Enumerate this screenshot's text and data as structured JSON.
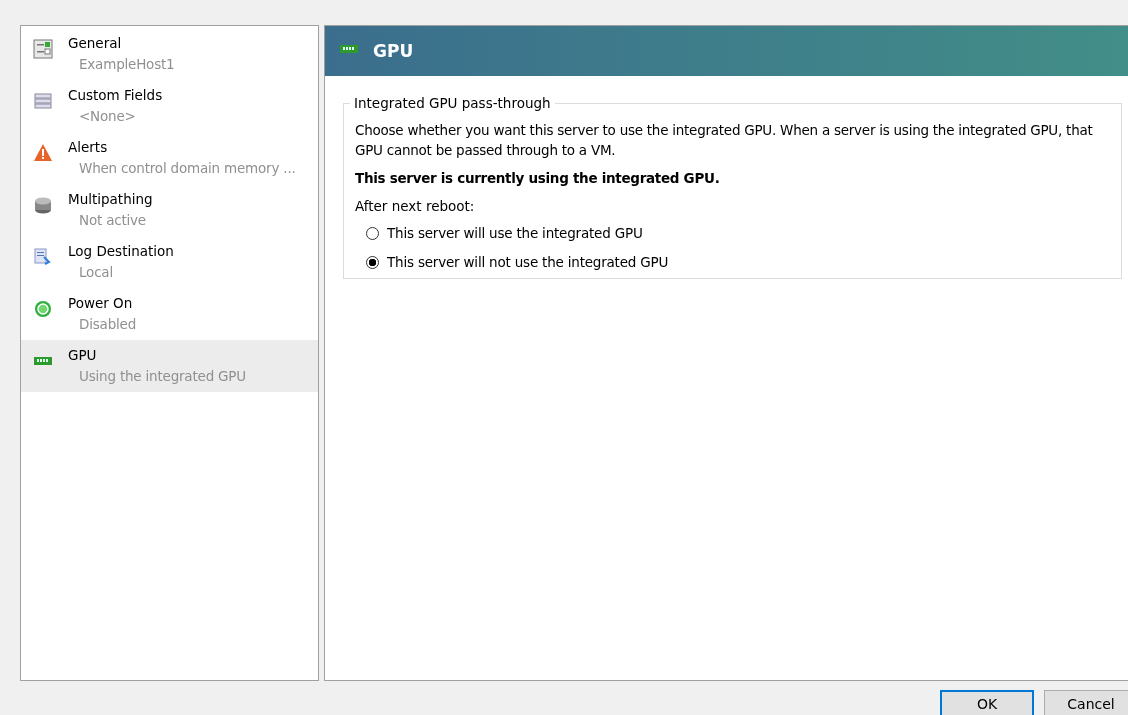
{
  "sidebar": {
    "items": [
      {
        "title": "General",
        "subtitle": "ExampleHost1",
        "selected": false
      },
      {
        "title": "Custom Fields",
        "subtitle": "<None>",
        "selected": false
      },
      {
        "title": "Alerts",
        "subtitle": "When control domain memory ...",
        "selected": false
      },
      {
        "title": "Multipathing",
        "subtitle": "Not active",
        "selected": false
      },
      {
        "title": "Log Destination",
        "subtitle": "Local",
        "selected": false
      },
      {
        "title": "Power On",
        "subtitle": "Disabled",
        "selected": false
      },
      {
        "title": "GPU",
        "subtitle": "Using the integrated GPU",
        "selected": true
      }
    ]
  },
  "header": {
    "title": "GPU"
  },
  "group": {
    "legend": "Integrated GPU pass-through",
    "description": "Choose whether you want this server to use the integrated GPU. When a server is using the integrated GPU, that GPU cannot be passed through to a VM.",
    "status": "This server is currently using the integrated GPU.",
    "prompt": "After next reboot:",
    "options": [
      {
        "label": "This server will use the integrated GPU",
        "selected": false
      },
      {
        "label": "This server will not use the integrated GPU",
        "selected": true
      }
    ]
  },
  "buttons": [
    {
      "label": "OK",
      "default": true
    },
    {
      "label": "Cancel",
      "default": false
    }
  ]
}
